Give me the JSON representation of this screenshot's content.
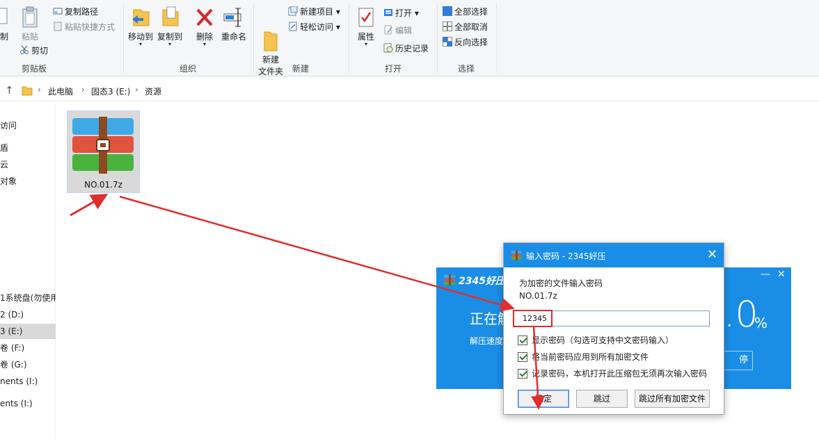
{
  "ribbon": {
    "clipboard": {
      "copy_partial": "制",
      "paste": "粘贴",
      "copy_path": "复制路径",
      "paste_shortcut": "粘贴快捷方式",
      "cut": "剪切",
      "group": "剪贴板"
    },
    "organize": {
      "move_to": "移动到",
      "copy_to": "复制到",
      "delete": "删除",
      "rename": "重命名",
      "group": "组织"
    },
    "new": {
      "new_folder": "新建\n文件夹",
      "new_item": "新建项目",
      "easy_access": "轻松访问",
      "group": "新建"
    },
    "open": {
      "properties": "属性",
      "open": "打开",
      "edit": "编辑",
      "history": "历史记录",
      "group": "打开"
    },
    "select": {
      "select_all": "全部选择",
      "select_none": "全部取消",
      "invert": "反向选择",
      "group": "选择"
    }
  },
  "address": {
    "crumbs": [
      "此电脑",
      "固态3 (E:)",
      "资源"
    ]
  },
  "nav": {
    "items": [
      "访问",
      "盾",
      "云",
      "对象",
      "1系统盘(勿使用",
      "2 (D:)",
      "3 (E:)",
      "卷 (F:)",
      "卷 (G:)",
      "nents (I:)",
      "ents (I:)"
    ]
  },
  "file": {
    "name": "NO.01.7z"
  },
  "progress_window": {
    "title": "2345好压",
    "status": "正在解",
    "speed_label": "解压速度",
    "percent": ".0",
    "percent_sign": "%",
    "pause_label": "停",
    "minimize": "—",
    "close": "✕"
  },
  "dialog": {
    "title": "输入密码 - 2345好压",
    "close": "✕",
    "prompt": "为加密的文件输入密码",
    "filename": "NO.01.7z",
    "password": "12345",
    "checkboxes": [
      {
        "label": "显示密码（勾选可支持中文密码输入）",
        "checked": true
      },
      {
        "label": "将当前密码应用到所有加密文件",
        "checked": true
      },
      {
        "label": "记录密码，本机打开此压缩包无须再次输入密码",
        "checked": true
      }
    ],
    "ok": "确定",
    "skip": "跳过",
    "skip_all": "跳过所有加密文件"
  },
  "colors": {
    "accent": "#1a8ee6",
    "annotation_red": "#e02d2d"
  }
}
